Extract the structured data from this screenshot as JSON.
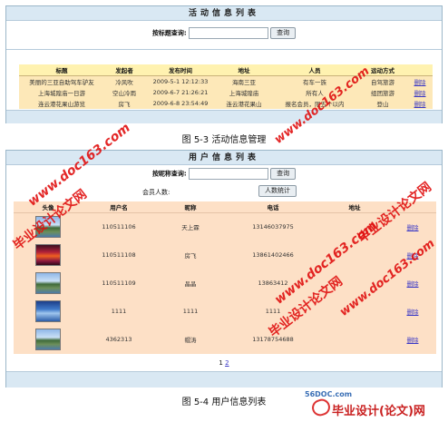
{
  "activity": {
    "title": "活动信息列表",
    "search_label": "按标题查询:",
    "search_value": "",
    "search_button": "查询",
    "columns": [
      "标题",
      "发起者",
      "发布时间",
      "地址",
      "人员",
      "运动方式",
      ""
    ],
    "rows": [
      [
        "美丽的三亚自助驾车驴友",
        "冷风吹",
        "2009-5-1 12:12:33",
        "海南三亚",
        "有车一族",
        "自驾旅游",
        "删除"
      ],
      [
        "上海城隍庙一日游",
        "空山冷雨",
        "2009-6-7 21:26:21",
        "上海城隍庙",
        "所有人",
        "组团旅游",
        "删除"
      ],
      [
        "连云港花果山游览",
        "房飞",
        "2009-6-8 23:54:49",
        "连云港花果山",
        "报名会员，限五个以内",
        "登山",
        "删除"
      ]
    ]
  },
  "caption1": "图 5-3 活动信息管理",
  "users": {
    "title": "用户信息列表",
    "search_label": "按昵称查询:",
    "search_value": "",
    "search_button": "查询",
    "count_label": "会员人数:",
    "count_button": "人数统计",
    "columns": [
      "头像",
      "用户名",
      "昵称",
      "电话",
      "地址",
      ""
    ],
    "rows": [
      {
        "avatar": "mountain-lake",
        "username": "110511106",
        "nickname": "天上霖",
        "phone": "13146037975",
        "address": "",
        "action": "删除"
      },
      {
        "avatar": "sunset-red",
        "username": "110511108",
        "nickname": "房飞",
        "phone": "13861402466",
        "address": "",
        "action": "删除"
      },
      {
        "avatar": "mountain-lake",
        "username": "110511109",
        "nickname": "晶晶",
        "phone": "13863412",
        "address": "",
        "action": "删除"
      },
      {
        "avatar": "blue-lake",
        "username": "1111",
        "nickname": "1111",
        "phone": "1111",
        "address": "",
        "action": "删除"
      },
      {
        "avatar": "mountain-lake",
        "username": "4362313",
        "nickname": "帽涛",
        "phone": "13178754688",
        "address": "",
        "action": "删除"
      }
    ],
    "pager": {
      "current": "1",
      "next": "2"
    }
  },
  "caption2": "图 5-4 用户信息列表",
  "watermarks": {
    "cn": "毕业设计论文网",
    "url": "www.doc163.com",
    "brand": "毕业设计(论文)网",
    "brand_site": "56DOC.com"
  },
  "colors": {
    "panel_border": "#9bb7c9",
    "bar": "#d9e8f3",
    "table_header_yellow": "#fff2b0",
    "row_orange": "#fde0c6",
    "link": "#3b39c6",
    "watermark": "#e01010"
  }
}
